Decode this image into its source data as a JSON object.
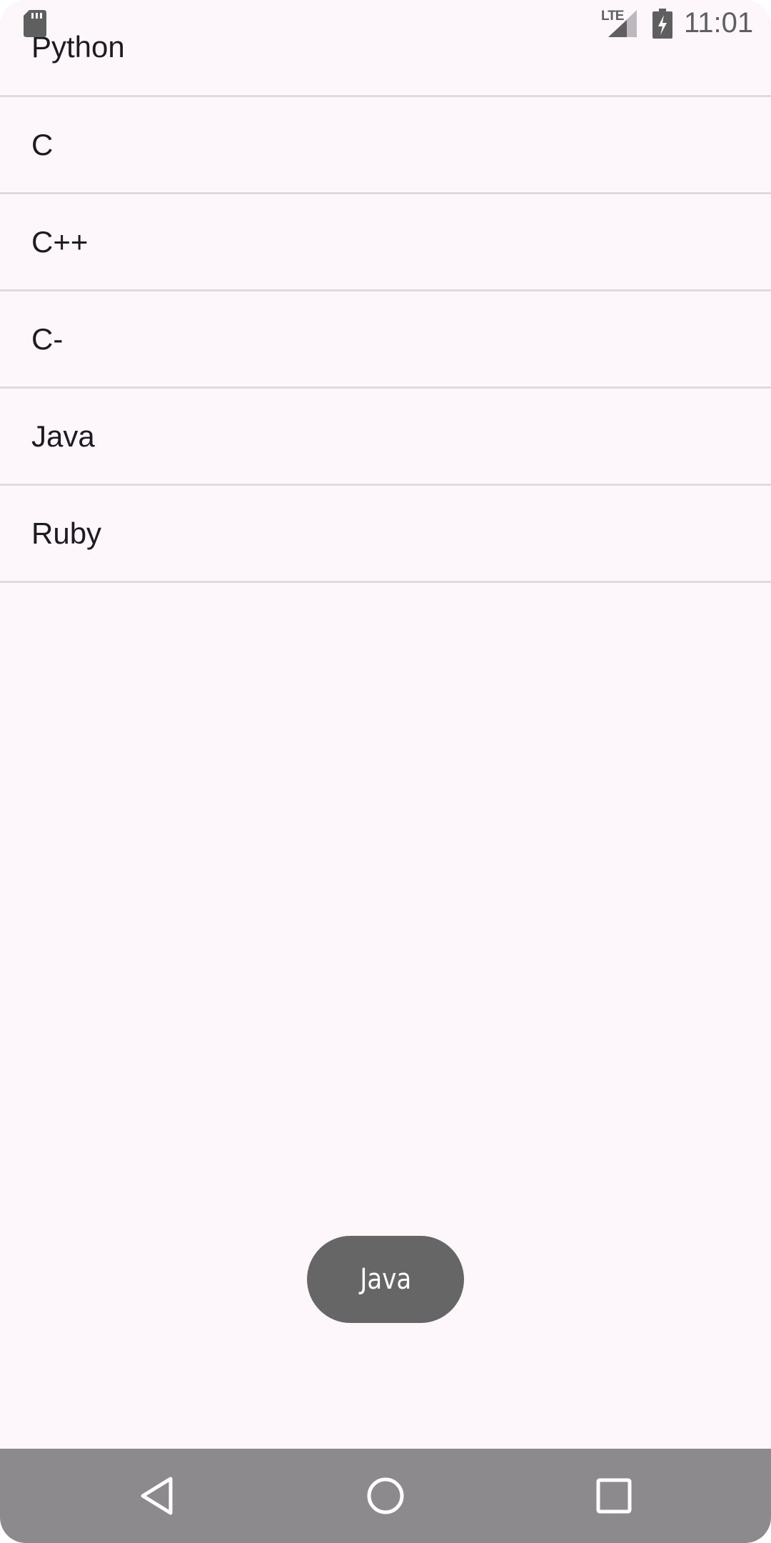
{
  "status_bar": {
    "network_label": "LTE",
    "time": "11:01",
    "icons": [
      "sd-card-icon",
      "signal-icon",
      "battery-charging-icon"
    ]
  },
  "list": {
    "items": [
      {
        "label": "Python"
      },
      {
        "label": "C"
      },
      {
        "label": "C++"
      },
      {
        "label": "C-"
      },
      {
        "label": "Java"
      },
      {
        "label": "Ruby"
      }
    ]
  },
  "toast": {
    "message": "Java"
  },
  "nav_bar": {
    "icons": [
      "back-icon",
      "home-icon",
      "recents-icon"
    ]
  },
  "colors": {
    "background": "#fdf7fc",
    "divider": "#dcdcdc",
    "toast_bg": "#666666",
    "nav_bar_bg": "#8c8a8d",
    "text": "#1d1b20"
  }
}
